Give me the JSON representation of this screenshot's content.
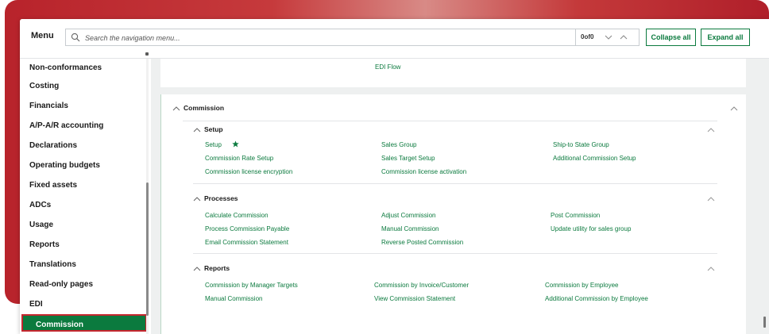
{
  "header": {
    "menu_label": "Menu",
    "search_placeholder": "Search the navigation menu...",
    "match_count": "0of0",
    "collapse_all": "Collapse all",
    "expand_all": "Expand all"
  },
  "sidebar": {
    "items": [
      {
        "label": "Non-conformances"
      },
      {
        "label": "Costing"
      },
      {
        "label": "Financials"
      },
      {
        "label": "A/P-A/R accounting"
      },
      {
        "label": "Declarations"
      },
      {
        "label": "Operating budgets"
      },
      {
        "label": "Fixed assets"
      },
      {
        "label": "ADCs"
      },
      {
        "label": "Usage"
      },
      {
        "label": "Reports"
      },
      {
        "label": "Translations"
      },
      {
        "label": "Read-only pages"
      },
      {
        "label": "EDI"
      },
      {
        "label": "Commission",
        "active": true
      }
    ]
  },
  "main": {
    "top_link": "EDI Flow",
    "commission": {
      "title": "Commission",
      "setup": {
        "title": "Setup",
        "links": [
          "Setup",
          "Sales Group",
          "Ship-to State Group",
          "Commission Rate Setup",
          "Sales Target Setup",
          "Additional Commission Setup",
          "Commission license encryption",
          "Commission license activation"
        ]
      },
      "processes": {
        "title": "Processes",
        "links": [
          "Calculate Commission",
          "Adjust Commission",
          "Post Commission",
          "Process Commission Payable",
          "Manual Commission",
          "Update utility for sales group",
          "Email Commission Statement",
          "Reverse Posted Commission"
        ]
      },
      "reports": {
        "title": "Reports",
        "links": [
          "Commission by Manager Targets",
          "Commission by Invoice/Customer",
          "Commission by Employee",
          "Manual Commission",
          "View Commission Statement",
          "Additional Commission by Employee"
        ]
      }
    }
  },
  "colors": {
    "accent_green": "#0b7a3e",
    "highlight_red": "#c4262e",
    "favorite_star": "#0b7a3e"
  },
  "icons": [
    "search-icon",
    "chevron-up-icon",
    "chevron-down-icon",
    "star-icon"
  ]
}
